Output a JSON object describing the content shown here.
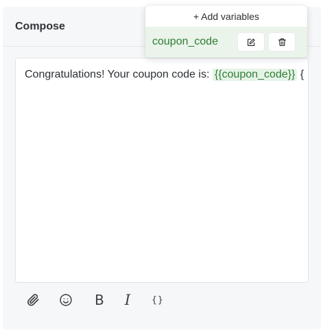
{
  "compose": {
    "title": "Compose"
  },
  "editor": {
    "text_before": "Congratulations! Your coupon code is: ",
    "variable_chip": "{{coupon_code}}",
    "text_after": " {"
  },
  "toolbar": {
    "icons": [
      "paperclip-icon",
      "emoji-icon",
      "bold-icon",
      "italic-icon",
      "variable-braces-icon"
    ],
    "bold_label": "B",
    "italic_label": "I",
    "code_label": "{}"
  },
  "variables_popover": {
    "add_label": "+ Add variables",
    "items": [
      {
        "name": "coupon_code"
      }
    ]
  },
  "colors": {
    "variable_green": "#2e7d32",
    "variable_bg": "#e6f4e8"
  }
}
